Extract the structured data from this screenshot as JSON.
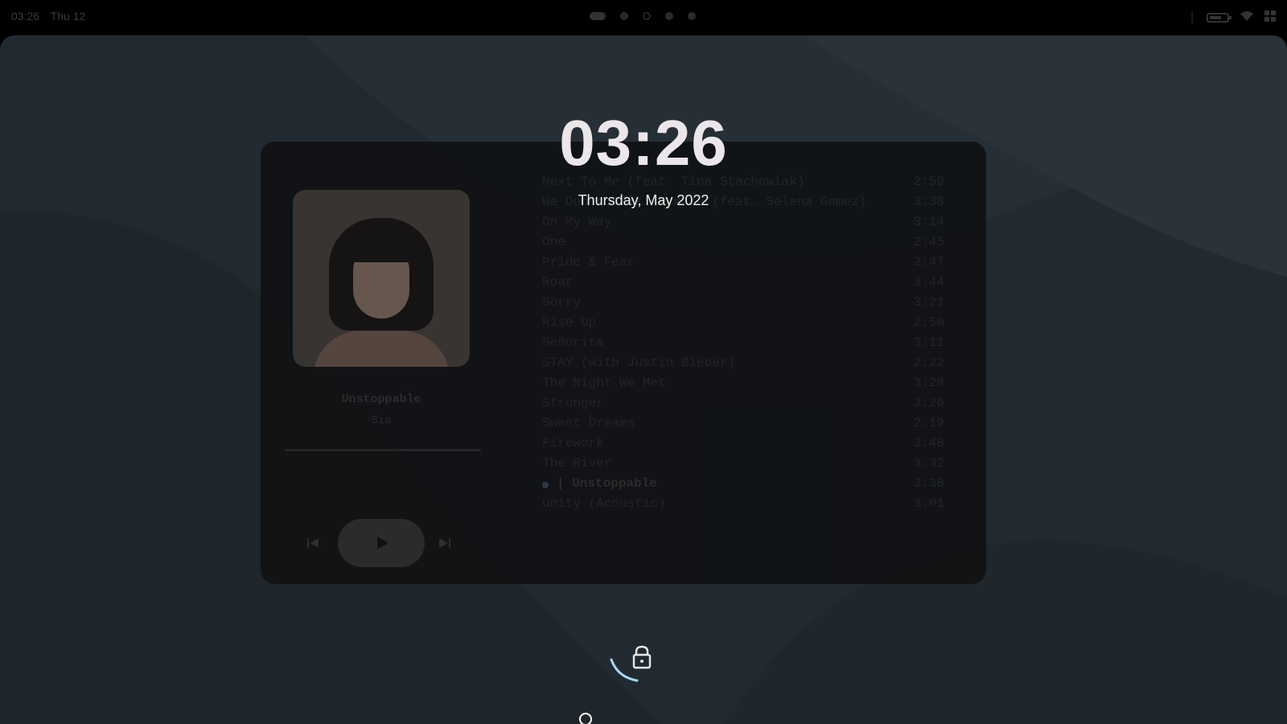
{
  "topbar": {
    "time": "03:26",
    "day": "Thu 12",
    "battery_level": 0.7
  },
  "lockscreen": {
    "clock": "03:26",
    "date": "Thursday, May 2022"
  },
  "player": {
    "now_playing": {
      "title": "Unstoppable",
      "artist": "Sia"
    },
    "progress": 0.0,
    "controls": {
      "prev_icon": "skip-previous-icon",
      "play_icon": "play-icon",
      "next_icon": "skip-next-icon"
    },
    "tracks": [
      {
        "title": "Next To Me (feat. Tina Stachowiak)",
        "duration": "2:59"
      },
      {
        "title": "We Don't Talk Anymore (feat. Selena Gomez)",
        "duration": "3:38"
      },
      {
        "title": "On My Way",
        "duration": "3:14"
      },
      {
        "title": "One",
        "duration": "2:45"
      },
      {
        "title": "Pride & Fear",
        "duration": "2:47"
      },
      {
        "title": "Roar",
        "duration": "3:44"
      },
      {
        "title": "Sorry",
        "duration": "3:21"
      },
      {
        "title": "Rise Up",
        "duration": "2:50"
      },
      {
        "title": "Señorita",
        "duration": "3:11"
      },
      {
        "title": "STAY (with Justin Bieber)",
        "duration": "2:22"
      },
      {
        "title": "The Night We Met",
        "duration": "3:28"
      },
      {
        "title": "Stronger",
        "duration": "3:26"
      },
      {
        "title": "Sweet Dreams",
        "duration": "2:19"
      },
      {
        "title": "Firework",
        "duration": "3:48"
      },
      {
        "title": "The River",
        "duration": "3:32"
      },
      {
        "title": "| Unstoppable",
        "duration": "3:38",
        "current": true
      },
      {
        "title": "Unity (Acoustic)",
        "duration": "3:01"
      }
    ]
  },
  "colors": {
    "background": "#222a31",
    "accent": "#a8d8f0",
    "clock": "#ebe6ea"
  },
  "icons": {
    "lock": "lock-icon",
    "wifi": "wifi-icon",
    "battery": "battery-icon",
    "grid": "grid-icon"
  }
}
